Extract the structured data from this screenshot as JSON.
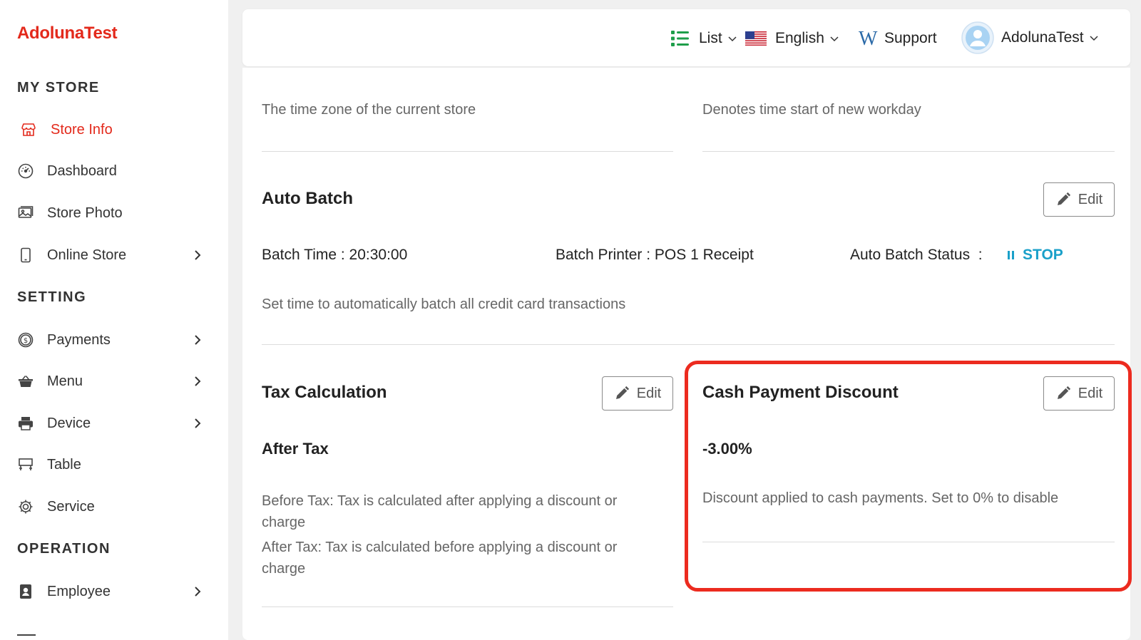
{
  "brand": "AdolunaTest",
  "sidebar": {
    "sections": {
      "my_store": "MY STORE",
      "setting": "SETTING",
      "operation": "OPERATION"
    },
    "items": {
      "store_info": "Store Info",
      "dashboard": "Dashboard",
      "store_photo": "Store Photo",
      "online_store": "Online Store",
      "payments": "Payments",
      "menu": "Menu",
      "device": "Device",
      "table": "Table",
      "service": "Service",
      "employee": "Employee"
    }
  },
  "topbar": {
    "list": "List",
    "language": "English",
    "support": "Support",
    "user": "AdolunaTest"
  },
  "timezone_desc": "The time zone of the current store",
  "workday_desc": "Denotes time start of new workday",
  "auto_batch": {
    "title": "Auto Batch",
    "edit_label": "Edit",
    "batch_time": "Batch Time : 20:30:00",
    "batch_printer": "Batch Printer : POS 1 Receipt",
    "status_label": "Auto Batch Status  :",
    "status_value": "STOP",
    "description": "Set time to automatically batch all credit card transactions"
  },
  "tax": {
    "title": "Tax Calculation",
    "edit_label": "Edit",
    "value": "After Tax",
    "desc_before": "Before Tax: Tax is calculated after applying a discount or charge",
    "desc_after": "After Tax: Tax is calculated before applying a discount or charge"
  },
  "cash_discount": {
    "title": "Cash Payment Discount",
    "edit_label": "Edit",
    "value": "-3.00%",
    "description": "Discount applied to cash payments. Set to 0% to disable"
  },
  "colors": {
    "brand_red": "#e3291b",
    "highlight_red": "#ec2b1f",
    "status_blue": "#1aa0c9",
    "list_green": "#1e9e4a"
  }
}
